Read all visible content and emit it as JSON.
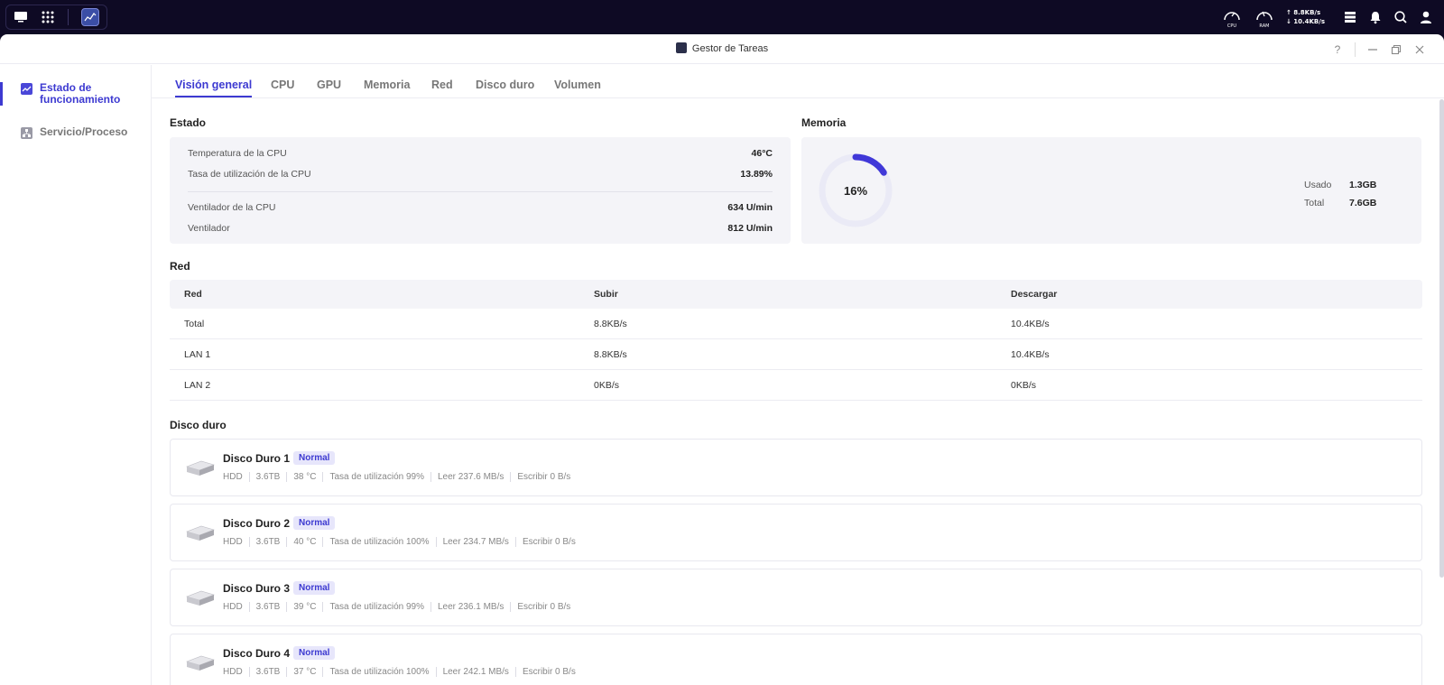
{
  "taskbar": {
    "net_up": "↑ 8.8KB/s",
    "net_down": "↓ 10.4KB/s",
    "cpu_label": "CPU",
    "ram_label": "RAM"
  },
  "window": {
    "title": "Gestor de Tareas",
    "help": "?"
  },
  "sidebar": {
    "items": [
      {
        "label": "Estado de funcionamiento",
        "icon": "activity-chart-icon"
      },
      {
        "label": "Servicio/Proceso",
        "icon": "process-tree-icon"
      }
    ]
  },
  "tabs": [
    "Visión general",
    "CPU",
    "GPU",
    "Memoria",
    "Red",
    "Disco duro",
    "Volumen"
  ],
  "estado": {
    "title": "Estado",
    "rows": [
      {
        "label": "Temperatura de la CPU",
        "value": "46°C"
      },
      {
        "label": "Tasa de utilización de la CPU",
        "value": "13.89%"
      },
      {
        "label": "Ventilador de la CPU",
        "value": "634 U/min"
      },
      {
        "label": "Ventilador",
        "value": "812 U/min"
      }
    ]
  },
  "memoria": {
    "title": "Memoria",
    "percent_label": "16%",
    "percent": 16,
    "used_label": "Usado",
    "used_value": "1.3GB",
    "total_label": "Total",
    "total_value": "7.6GB"
  },
  "red": {
    "title": "Red",
    "headers": [
      "Red",
      "Subir",
      "Descargar"
    ],
    "rows": [
      [
        "Total",
        "8.8KB/s",
        "10.4KB/s"
      ],
      [
        "LAN 1",
        "8.8KB/s",
        "10.4KB/s"
      ],
      [
        "LAN 2",
        "0KB/s",
        "0KB/s"
      ]
    ]
  },
  "disco": {
    "title": "Disco duro",
    "disks": [
      {
        "name": "Disco Duro 1",
        "status": "Normal",
        "type": "HDD",
        "size": "3.6TB",
        "temp": "38 °C",
        "util": "Tasa de utilización 99%",
        "read": "Leer 237.6 MB/s",
        "write": "Escribir 0 B/s"
      },
      {
        "name": "Disco Duro 2",
        "status": "Normal",
        "type": "HDD",
        "size": "3.6TB",
        "temp": "40 °C",
        "util": "Tasa de utilización 100%",
        "read": "Leer 234.7 MB/s",
        "write": "Escribir 0 B/s"
      },
      {
        "name": "Disco Duro 3",
        "status": "Normal",
        "type": "HDD",
        "size": "3.6TB",
        "temp": "39 °C",
        "util": "Tasa de utilización 99%",
        "read": "Leer 236.1 MB/s",
        "write": "Escribir 0 B/s"
      },
      {
        "name": "Disco Duro 4",
        "status": "Normal",
        "type": "HDD",
        "size": "3.6TB",
        "temp": "37 °C",
        "util": "Tasa de utilización 100%",
        "read": "Leer 242.1 MB/s",
        "write": "Escribir 0 B/s"
      }
    ]
  },
  "colors": {
    "accent": "#3d3ad1",
    "taskbar_bg": "#0e0a24"
  }
}
